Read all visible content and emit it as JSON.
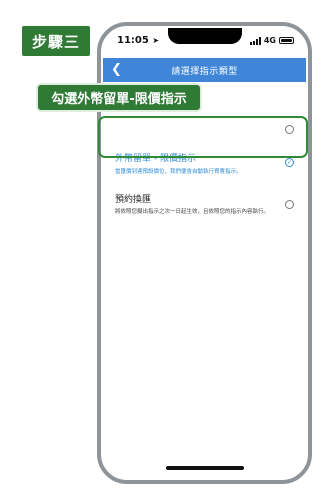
{
  "step_badge": "步驟三",
  "callout": "勾選外幣留單-限價指示",
  "status_bar": {
    "time": "11:05",
    "network": "4G"
  },
  "header": {
    "back_icon": "chevron-left-icon",
    "title": "請選擇指示類型"
  },
  "options": [
    {
      "title": "",
      "description": "",
      "selected": false
    },
    {
      "title": "外幣留單 - 限價指示",
      "description": "當匯價到達預設價位，我們便會自動執行買賣指示。",
      "selected": true
    },
    {
      "title": "預約換匯",
      "description": "將依照您擬出指示之次一日起生效，且依照您的指示內容執行。",
      "selected": false
    }
  ],
  "colors": {
    "accent": "#3f86d8",
    "selected": "#2e8bd8",
    "callout_green": "#2f7a34"
  }
}
